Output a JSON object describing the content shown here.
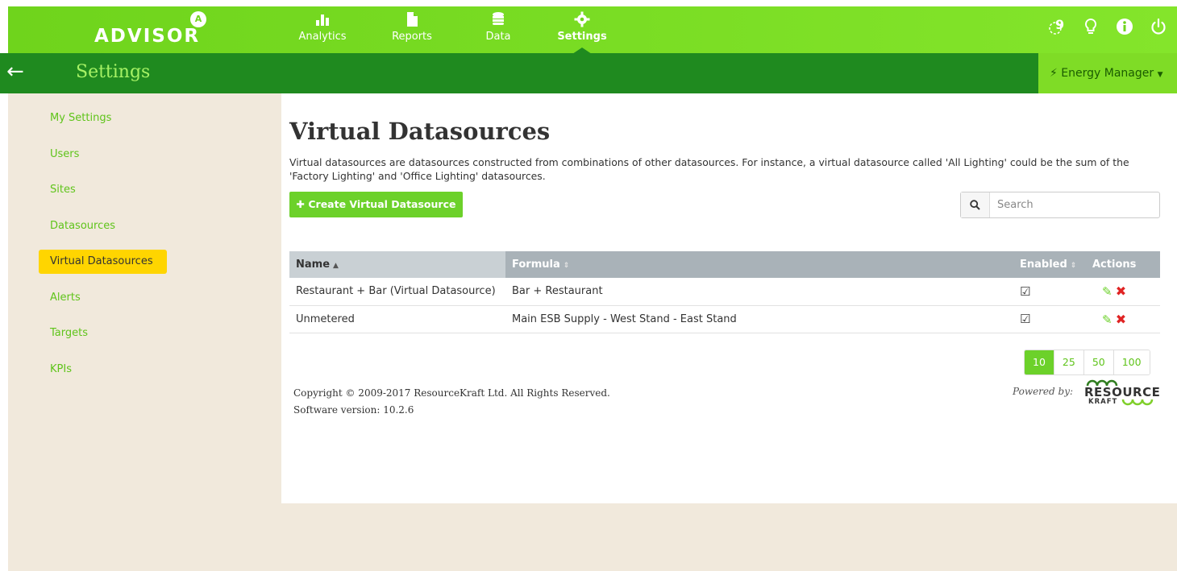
{
  "app": {
    "logo": "ADVISOR",
    "logo_mark": "A"
  },
  "nav": {
    "items": [
      {
        "label": "Analytics",
        "icon": "bar-chart-icon"
      },
      {
        "label": "Reports",
        "icon": "file-icon"
      },
      {
        "label": "Data",
        "icon": "database-icon"
      },
      {
        "label": "Settings",
        "icon": "gear-icon",
        "active": true
      }
    ],
    "notifications_count": "9"
  },
  "titlebar": {
    "title": "Settings",
    "role": "Energy Manager",
    "role_icon": "⚡"
  },
  "sidebar": {
    "items": [
      {
        "label": "My Settings"
      },
      {
        "label": "Users"
      },
      {
        "label": "Sites"
      },
      {
        "label": "Datasources"
      },
      {
        "label": "Virtual Datasources",
        "active": true
      },
      {
        "label": "Alerts"
      },
      {
        "label": "Targets"
      },
      {
        "label": "KPIs"
      }
    ]
  },
  "main": {
    "heading": "Virtual Datasources",
    "description": "Virtual datasources are datasources constructed from combinations of other datasources. For instance, a virtual datasource called 'All Lighting' could be the sum of the 'Factory Lighting' and 'Office Lighting' datasources.",
    "create_button": "Create Virtual Datasource",
    "search_placeholder": "Search"
  },
  "table": {
    "headers": {
      "name": "Name",
      "formula": "Formula",
      "enabled": "Enabled",
      "actions": "Actions"
    },
    "rows": [
      {
        "name": "Restaurant + Bar (Virtual Datasource)",
        "formula": "Bar + Restaurant",
        "enabled": true
      },
      {
        "name": "Unmetered",
        "formula": "Main ESB Supply - West Stand - East Stand",
        "enabled": true
      }
    ]
  },
  "pagination": {
    "page_sizes": [
      "10",
      "25",
      "50",
      "100"
    ],
    "selected": "10"
  },
  "footer": {
    "copyright": "Copyright © 2009-2017 ResourceKraft Ltd. All Rights Reserved.",
    "version": "Software version: 10.2.6",
    "powered_by": "Powered by:",
    "brand_main": "RESOURCE",
    "brand_sub": "KRAFT"
  },
  "colors": {
    "brand_green": "#6fd41c",
    "dark_green": "#1f8a1f",
    "active_yellow": "#ffd500",
    "delete_red": "#e02424"
  }
}
